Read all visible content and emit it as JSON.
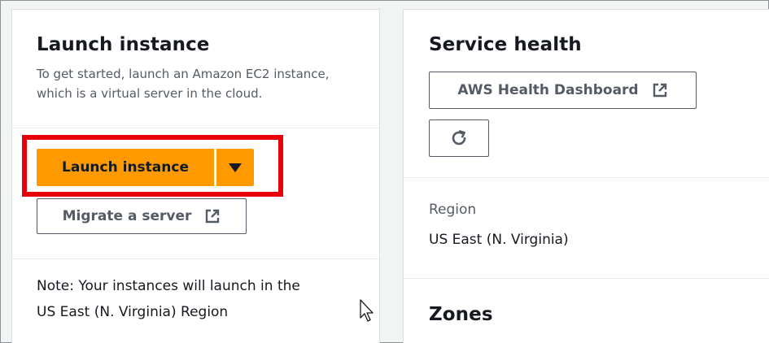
{
  "launch": {
    "title": "Launch instance",
    "description_line1": "To get started, launch an Amazon EC2 instance,",
    "description_line2": "which is a virtual server in the cloud.",
    "launch_button_label": "Launch instance",
    "dropdown_icon": "caret-down-icon",
    "migrate_button_label": "Migrate a server",
    "note_line1": "Note: Your instances will launch in the",
    "note_line2": "US East (N. Virginia) Region"
  },
  "service_health": {
    "title": "Service health",
    "dashboard_button_label": "AWS Health Dashboard",
    "refresh_icon": "refresh-icon",
    "region_label": "Region",
    "region_value": "US East (N. Virginia)",
    "zones_title": "Zones"
  },
  "colors": {
    "primary": "#ff9900",
    "highlight": "#e8000b",
    "text": "#16191f",
    "muted": "#545b64"
  }
}
